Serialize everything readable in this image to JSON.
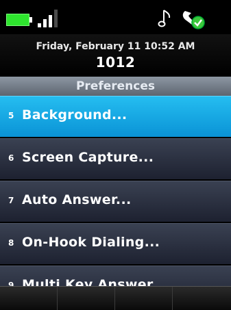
{
  "status_bar": {
    "battery_icon": "battery-full-icon",
    "signal_icon": "signal-strength-icon",
    "ringer_icon": "music-note-icon",
    "presence_icon": "handset-presence-icon",
    "battery_color": "#2ee52e",
    "presence_color": "#3cc83c"
  },
  "header": {
    "datetime": "Friday, February 11 10:52 AM",
    "extension": "1012"
  },
  "title": "Preferences",
  "menu": {
    "selected_index": 0,
    "selected_color": "#1aa9e6",
    "items": [
      {
        "number": "5",
        "label": "Background..."
      },
      {
        "number": "6",
        "label": "Screen Capture..."
      },
      {
        "number": "7",
        "label": "Auto Answer..."
      },
      {
        "number": "8",
        "label": "On-Hook Dialing..."
      },
      {
        "number": "9",
        "label": "Multi Key Answer"
      }
    ]
  },
  "softkeys": [
    "",
    "",
    "",
    ""
  ]
}
